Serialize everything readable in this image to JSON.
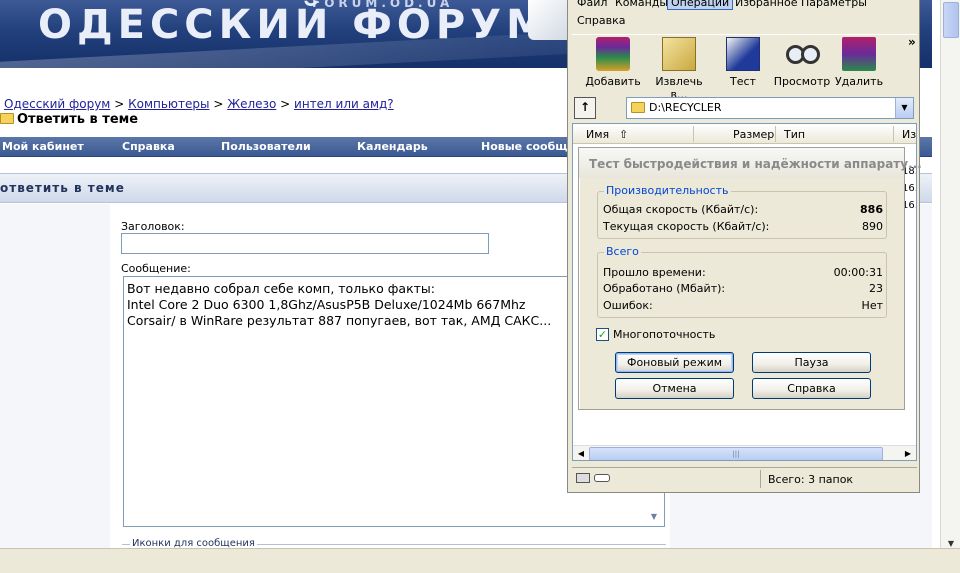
{
  "forum": {
    "banner_title": "ОДЕССКИЙ ФОРУМ",
    "banner_sub": "FORUM.OD.UA",
    "breadcrumb": [
      "Одесский форум",
      "Компьютеры",
      "Железо",
      "интел или амд?"
    ],
    "breadcrumb_sep": ">",
    "reply_title": "Ответить в теме",
    "nav": [
      "Мой кабинет",
      "Справка",
      "Пользователи",
      "Календарь",
      "Новые сообще"
    ],
    "section_title": "ответить в теме",
    "subject_label": "Заголовок:",
    "subject_value": "",
    "message_label": "Сообщение:",
    "message_lines": [
      "Вот недавно собрал себе комп, только факты:",
      "Intel Core 2 Duo 6300 1,8Ghz/AsusP5B Deluxe/1024Mb 667Mhz",
      "Corsair/ в WinRare результат 887 попугаев, вот так, АМД САКС..."
    ],
    "icons_legend": "Иконки для сообщения"
  },
  "winrar": {
    "menu_row1": [
      "Файл",
      "Команды",
      "Операции",
      "Избранное",
      "Параметры"
    ],
    "menu_row2": [
      "Справка"
    ],
    "menu_active": "Операции",
    "toolbar": [
      "Добавить",
      "Извлечь в...",
      "Тест",
      "Просмотр",
      "Удалить"
    ],
    "toolbar_more": "»",
    "path": "D:\\RECYCLER",
    "columns": [
      "Имя",
      "Размер",
      "Тип",
      "Из"
    ],
    "dates": [
      "18.",
      "16.",
      "16."
    ],
    "status": "Всего: 3 папок"
  },
  "benchmark": {
    "title": "Тест быстродействия и надёжности аппарату...",
    "perf_group": "Производительность",
    "total_speed_label": "Общая скорость (Кбайт/с):",
    "total_speed_value": "886",
    "current_speed_label": "Текущая скорость (Кбайт/с):",
    "current_speed_value": "890",
    "total_group": "Всего",
    "elapsed_label": "Прошло времени:",
    "elapsed_value": "00:00:31",
    "processed_label": "Обработано (Мбайт):",
    "processed_value": "23",
    "errors_label": "Ошибок:",
    "errors_value": "Нет",
    "multithread_label": "Многопоточность",
    "multithread_checked": true,
    "buttons": {
      "background": "Фоновый режим",
      "pause": "Пауза",
      "cancel": "Отмена",
      "help": "Справка"
    }
  }
}
